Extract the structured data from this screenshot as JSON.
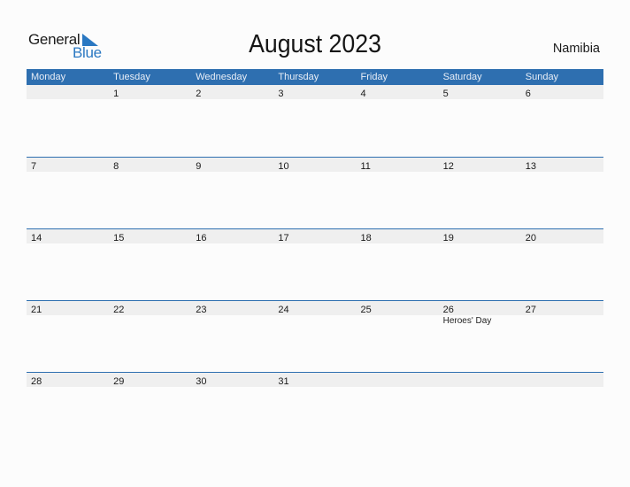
{
  "logo": {
    "general": "General",
    "blue": "Blue",
    "icon": "triangle-flag-icon"
  },
  "title": "August 2023",
  "country": "Namibia",
  "colors": {
    "accent": "#2e6fb0",
    "row_bg": "#efefef",
    "logo_blue": "#2a78c2"
  },
  "weekdays": [
    "Monday",
    "Tuesday",
    "Wednesday",
    "Thursday",
    "Friday",
    "Saturday",
    "Sunday"
  ],
  "weeks": [
    [
      {
        "day": ""
      },
      {
        "day": "1"
      },
      {
        "day": "2"
      },
      {
        "day": "3"
      },
      {
        "day": "4"
      },
      {
        "day": "5"
      },
      {
        "day": "6"
      }
    ],
    [
      {
        "day": "7"
      },
      {
        "day": "8"
      },
      {
        "day": "9"
      },
      {
        "day": "10"
      },
      {
        "day": "11"
      },
      {
        "day": "12"
      },
      {
        "day": "13"
      }
    ],
    [
      {
        "day": "14"
      },
      {
        "day": "15"
      },
      {
        "day": "16"
      },
      {
        "day": "17"
      },
      {
        "day": "18"
      },
      {
        "day": "19"
      },
      {
        "day": "20"
      }
    ],
    [
      {
        "day": "21"
      },
      {
        "day": "22"
      },
      {
        "day": "23"
      },
      {
        "day": "24"
      },
      {
        "day": "25"
      },
      {
        "day": "26",
        "holiday": "Heroes' Day"
      },
      {
        "day": "27"
      }
    ],
    [
      {
        "day": "28"
      },
      {
        "day": "29"
      },
      {
        "day": "30"
      },
      {
        "day": "31"
      },
      {
        "day": ""
      },
      {
        "day": ""
      },
      {
        "day": ""
      }
    ]
  ]
}
